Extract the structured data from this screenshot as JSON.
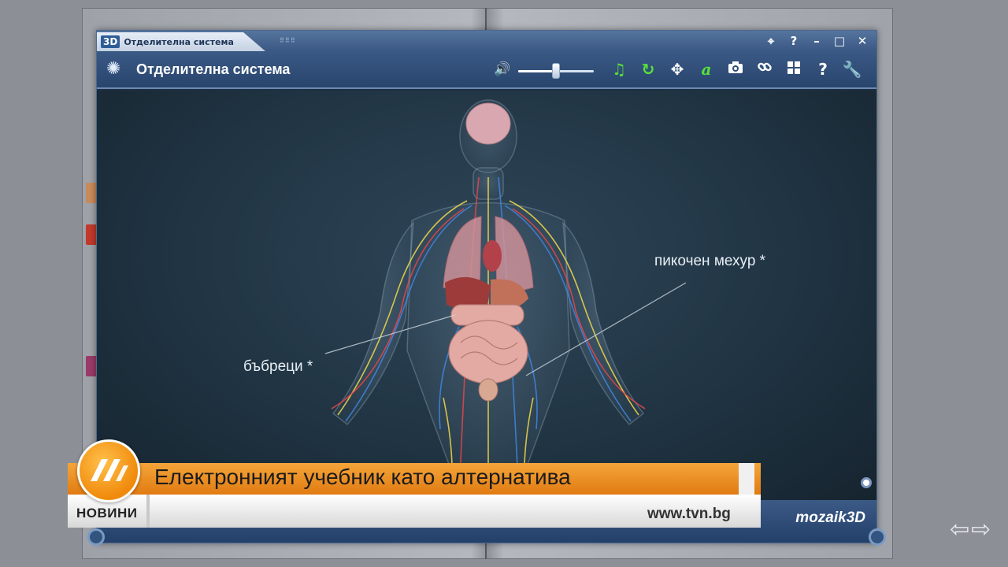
{
  "window": {
    "tab_logo": "3D",
    "title": "Отделителна система",
    "controls": {
      "pin": "✕",
      "help": "?",
      "minimize": "–",
      "maximize": "□",
      "close": "✕"
    }
  },
  "toolbar": {
    "title": "Отделителна система",
    "volume": {
      "level": 0.5
    },
    "icons": [
      "music-icon",
      "rotate-icon",
      "move-icon",
      "font-icon",
      "camera-icon",
      "link-icon",
      "grid-icon",
      "help-icon",
      "wrench-icon"
    ]
  },
  "scene": {
    "labels": {
      "bladder": "пикочен мехур *",
      "kidneys": "бъбреци *"
    }
  },
  "footer": {
    "brand": "mozaik3D"
  },
  "ticker": {
    "headline": "Електронният учебник като алтернатива",
    "channel": "НОВИНИ",
    "url": "www.tvn.bg"
  },
  "colors": {
    "accent_orange": "#f08a0c",
    "window_blue": "#3a5985",
    "active_green": "#58e03a"
  }
}
